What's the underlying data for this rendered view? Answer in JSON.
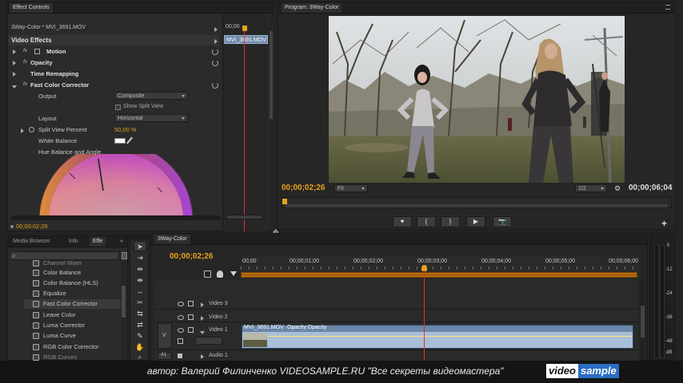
{
  "effect_controls": {
    "tab_label": "Effect Controls",
    "clip_path": "3Way-Color * MVI_3691.MOV",
    "mini_time": "00;00",
    "mini_clip": "MVI_3691.MOV",
    "video_effects": "Video Effects",
    "motion": "Motion",
    "opacity": "Opacity",
    "time_remap": "Time Remapping",
    "fcc": "Fast Color Corrector",
    "fx": "fx",
    "output_label": "Output",
    "output_value": "Composite",
    "show_split": "Show Split View",
    "layout_label": "Layout",
    "layout_value": "Horizontal",
    "split_label": "Split View Percent",
    "split_value": "50,00 %",
    "wb_label": "White Balance",
    "hue_label": "Hue Balance and Angle",
    "timecode": "00;00;02;26"
  },
  "program": {
    "tab_label": "Program: 3Way-Color",
    "timecode_left": "00;00;02;26",
    "fit": "Fit",
    "resolution": "1/2",
    "timecode_right": "00;00;06;04",
    "buttons": [
      "♥",
      "{",
      "}",
      "▶",
      "📷"
    ],
    "add": "+"
  },
  "project": {
    "tabs": [
      "Media Browser",
      "Info",
      "Effe"
    ],
    "effects": [
      "Channel Mixer",
      "Color Balance",
      "Color Balance (HLS)",
      "Equalize",
      "Fast Color Corrector",
      "Leave Color",
      "Luma Corrector",
      "Luma Curve",
      "RGB Color Corrector",
      "RGB Curves"
    ]
  },
  "timeline": {
    "tab_label": "3Way-Color",
    "timecode": "00;00;02;26",
    "ruler": [
      "00;00",
      "00;00;01;00",
      "00;00;02;00",
      "00;00;03;00",
      "00;00;04;00",
      "00;00;05;00",
      "00;00;06;00"
    ],
    "tracks": [
      "Video 3",
      "Video 2",
      "Video 1",
      "Audio 1"
    ],
    "clip_name": "MVI_3691.MOV",
    "clip_opacity": "Opacity:Opacity",
    "v_label": "V",
    "a_label": "A1"
  },
  "meter": {
    "scale": [
      "0",
      "-12",
      "-24",
      "-36",
      "-48",
      "dB"
    ]
  },
  "caption": {
    "text": "автор: Валерий Филинченко   VIDEOSAMPLE.RU   \"Все секреты видеомастера\"",
    "logo_a": "video",
    "logo_b": "sample"
  },
  "colors": {
    "accent": "#e8a21b",
    "playhead": "#e03030"
  }
}
